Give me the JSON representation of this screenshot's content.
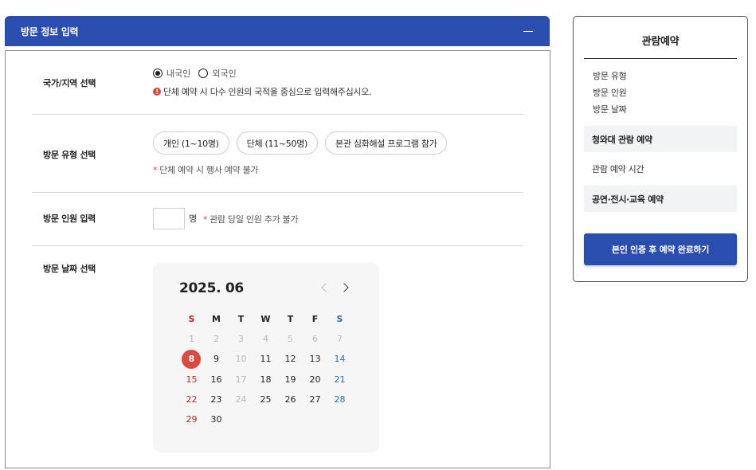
{
  "panel": {
    "title": "방문 정보 입력"
  },
  "nation": {
    "label": "국가/지역 선택",
    "options": [
      "내국인",
      "외국인"
    ],
    "selected": "내국인",
    "notice_icon": "!",
    "notice": "단체 예약 시 다수 인원의 국적을 중심으로 입력해주십시오."
  },
  "visit_type": {
    "label": "방문 유형 선택",
    "options": [
      "개인 (1~10명)",
      "단체 (11~50명)",
      "본관 심화해설 프로그램 참가"
    ],
    "note_star": "*",
    "note": "단체 예약 시 행사 예약 불가"
  },
  "count": {
    "label": "방문 인원 입력",
    "value": "",
    "unit": "명",
    "note_star": "*",
    "note": "관람 당일 인원 추가 불가"
  },
  "date": {
    "label": "방문 날짜 선택",
    "calendar": {
      "title": "2025. 06",
      "dow": [
        "S",
        "M",
        "T",
        "W",
        "T",
        "F",
        "S"
      ],
      "days": [
        [
          "1",
          "2",
          "3",
          "4",
          "5",
          "6",
          "7"
        ],
        [
          "8",
          "9",
          "10",
          "11",
          "12",
          "13",
          "14"
        ],
        [
          "15",
          "16",
          "17",
          "18",
          "19",
          "20",
          "21"
        ],
        [
          "22",
          "23",
          "24",
          "25",
          "26",
          "27",
          "28"
        ],
        [
          "29",
          "30",
          "",
          "",
          "",
          "",
          ""
        ]
      ],
      "selected": "8"
    }
  },
  "side": {
    "title": "관람예약",
    "items": [
      "방문 유형",
      "방문 인원",
      "방문 날짜"
    ],
    "sections": [
      "청와대 관람 예약",
      "관람 예약 시간",
      "공연·전시·교육 예약"
    ],
    "cta": "본인 인증 후 예약 완료하기"
  },
  "colors": {
    "primary": "#2a4db0",
    "accent_red": "#d94b3d",
    "sunday": "#c0232b",
    "saturday": "#2a6bb5"
  }
}
